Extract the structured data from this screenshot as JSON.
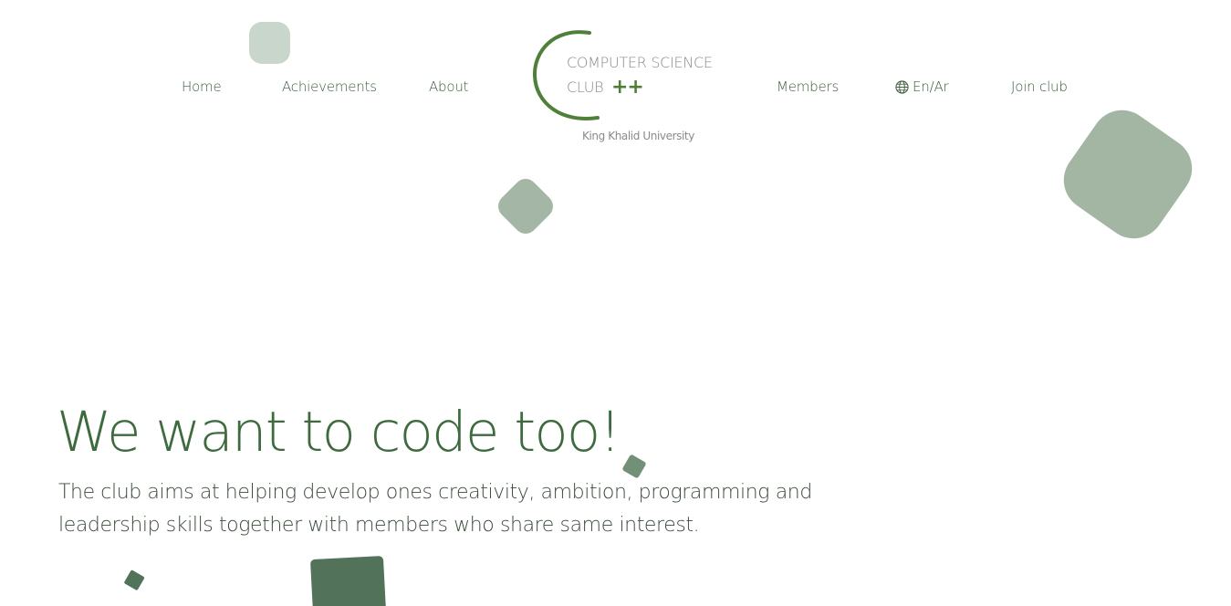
{
  "nav": {
    "home": "Home",
    "achievements": "Achievements",
    "about": "About",
    "members": "Members",
    "language": "En/Ar",
    "join": "Join club"
  },
  "logo": {
    "line1": "COMPUTER SCIENCE",
    "line2": "CLUB",
    "plus": "++",
    "subtitle": "King Khalid University"
  },
  "hero": {
    "title": "We want to code too!",
    "description": "The club aims at helping develop ones creativity, ambition, programming and leadership skills together with members who share same interest."
  },
  "colors": {
    "accent": "#4f7f3a",
    "heading": "#3d6b3d",
    "shape_light": "#c9d6cb",
    "shape_mid": "#a3b6a4",
    "shape_dark": "#52735a"
  }
}
